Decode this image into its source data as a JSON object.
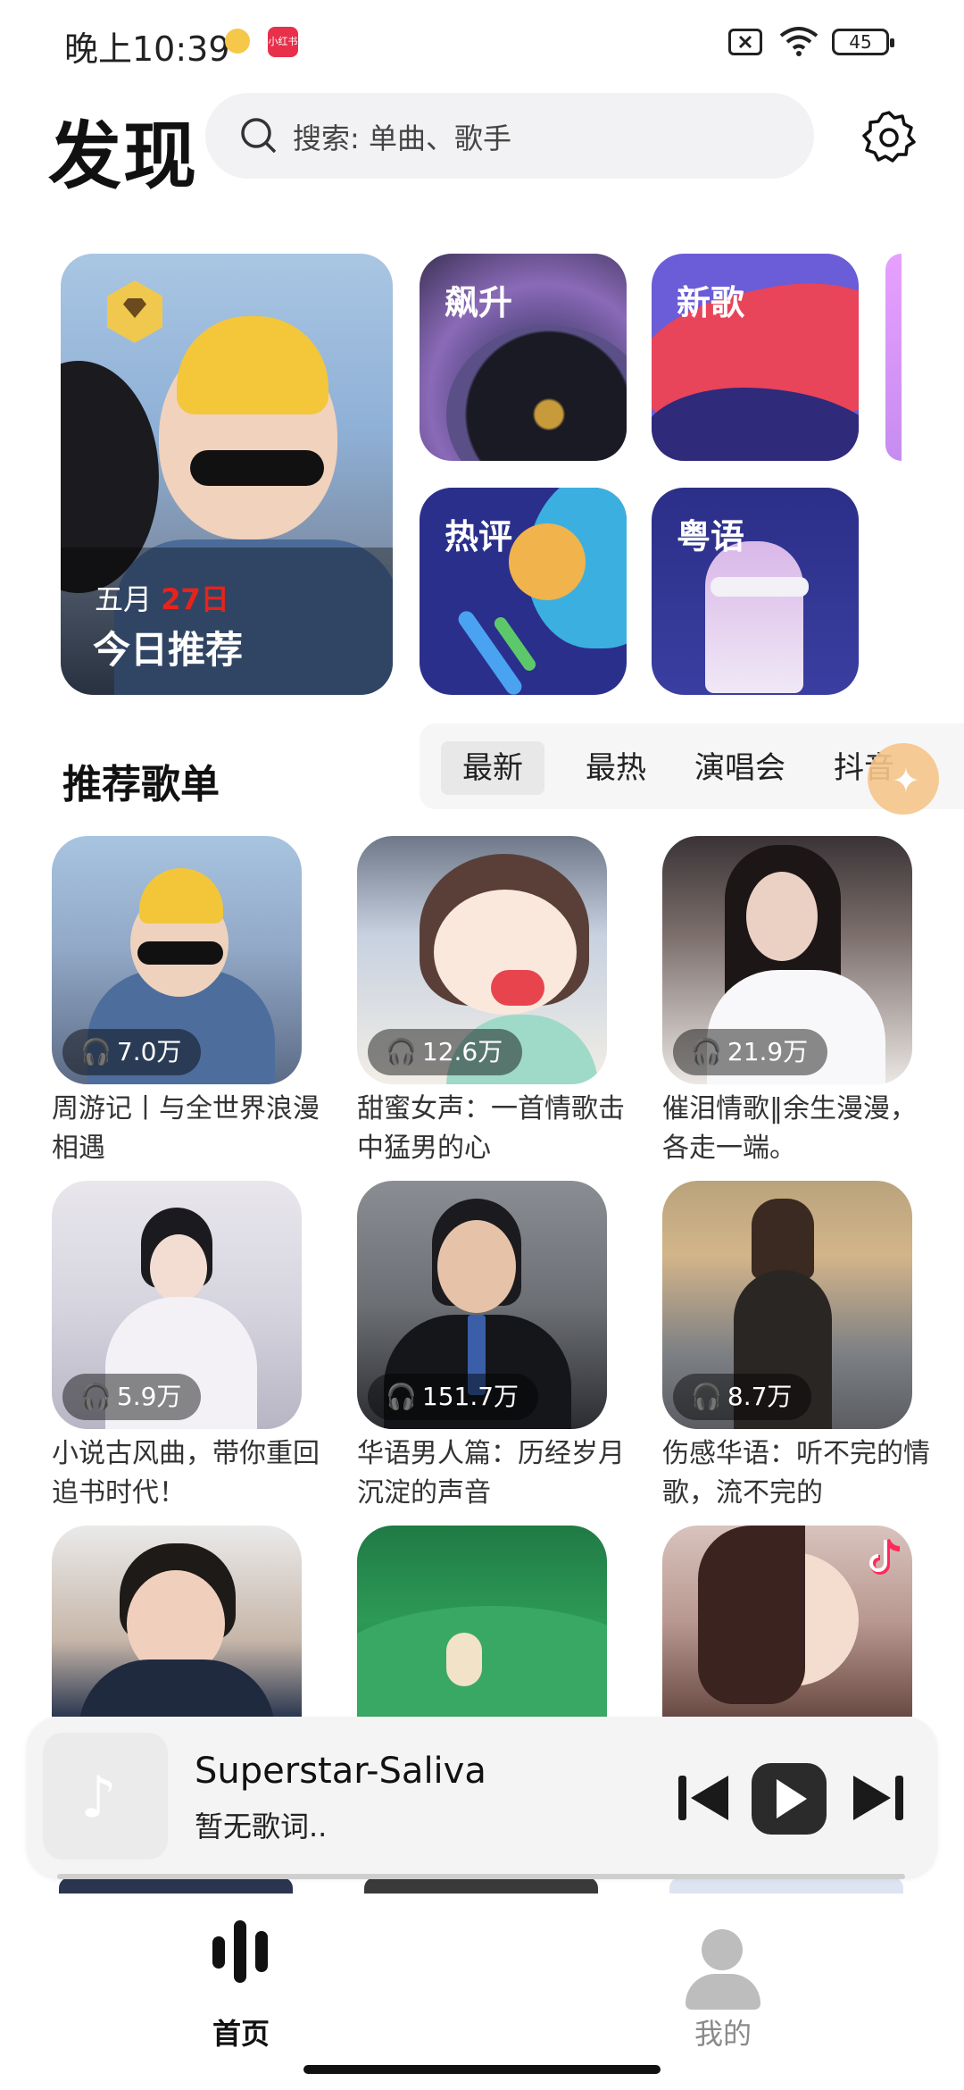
{
  "status_bar": {
    "time": "晚上10:39",
    "app_badge": "小红书",
    "battery": "45"
  },
  "header": {
    "title": "发现",
    "search_placeholder": "搜索: 单曲、歌手"
  },
  "featured": {
    "daily": {
      "month": "五月",
      "day": "27日",
      "title": "今日推荐"
    },
    "cards": [
      {
        "label": "飙升"
      },
      {
        "label": "新歌"
      },
      {
        "label": "热评"
      },
      {
        "label": "粤语"
      }
    ]
  },
  "section": {
    "title": "推荐歌单",
    "tabs": [
      "最新",
      "最热",
      "演唱会",
      "抖音"
    ]
  },
  "playlists": [
    {
      "plays": "7.0万",
      "name": "周游记丨与全世界浪漫相遇"
    },
    {
      "plays": "12.6万",
      "name": "甜蜜女声：一首情歌击中猛男的心"
    },
    {
      "plays": "21.9万",
      "name": "催泪情歌‖余生漫漫，各走一端。"
    },
    {
      "plays": "5.9万",
      "name": "小说古风曲，带你重回追书时代！"
    },
    {
      "plays": "151.7万",
      "name": "华语男人篇：历经岁月沉淀的声音"
    },
    {
      "plays": "8.7万",
      "name": "伤感华语：听不完的情歌，流不完的"
    }
  ],
  "player": {
    "song": "Superstar-Saliva",
    "lyric": "暂无歌词.."
  },
  "nav": {
    "home": "首页",
    "me": "我的"
  },
  "colors": {
    "accent_red": "#e8231b",
    "float_button": "#f7c68a",
    "text_dark": "#111111"
  }
}
